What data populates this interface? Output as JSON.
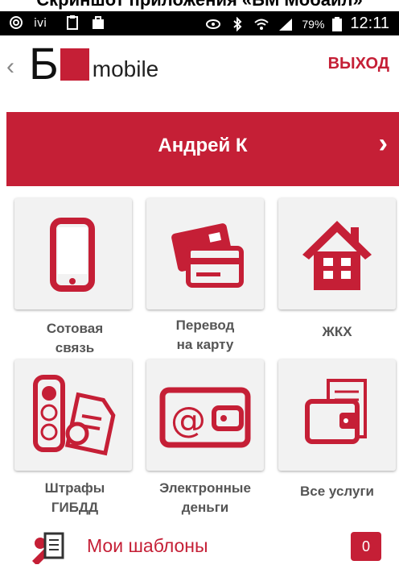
{
  "caption": "Скриншот приложения «БМ Мобайл»",
  "status_bar": {
    "battery": "79%",
    "time": "12:11",
    "left_icons": [
      "at-icon",
      "ivi-icon",
      "clipboard-icon",
      "bag-icon"
    ],
    "right_icons": [
      "eye-icon",
      "bluetooth-icon",
      "wifi-icon",
      "signal-icon",
      "battery-icon"
    ]
  },
  "header": {
    "back_icon": "chevron-left-icon",
    "logo_text": "Б",
    "logo_sub": "mobile",
    "logout_label": "ВЫХОД"
  },
  "banner": {
    "user_name": "Андрей К",
    "chevron": "›"
  },
  "tiles": [
    {
      "icon": "mobile-phone-icon",
      "line1": "Сотовая",
      "line2": "связь"
    },
    {
      "icon": "card-transfer-icon",
      "line1": "Перевод",
      "line2": "на карту"
    },
    {
      "icon": "house-icon",
      "line1": "ЖКХ",
      "line2": ""
    },
    {
      "icon": "traffic-fines-icon",
      "line1": "Штрафы",
      "line2": "ГИБДД"
    },
    {
      "icon": "e-wallet-icon",
      "line1": "Электронные",
      "line2": "деньги"
    },
    {
      "icon": "all-services-icon",
      "line1": "Все услуги",
      "line2": ""
    }
  ],
  "templates": {
    "icon": "edit-list-icon",
    "label": "Мои шаблоны",
    "count": "0"
  },
  "colors": {
    "accent": "#c51f36",
    "tile_bg": "#f2f2f2",
    "label_text": "#555555"
  }
}
